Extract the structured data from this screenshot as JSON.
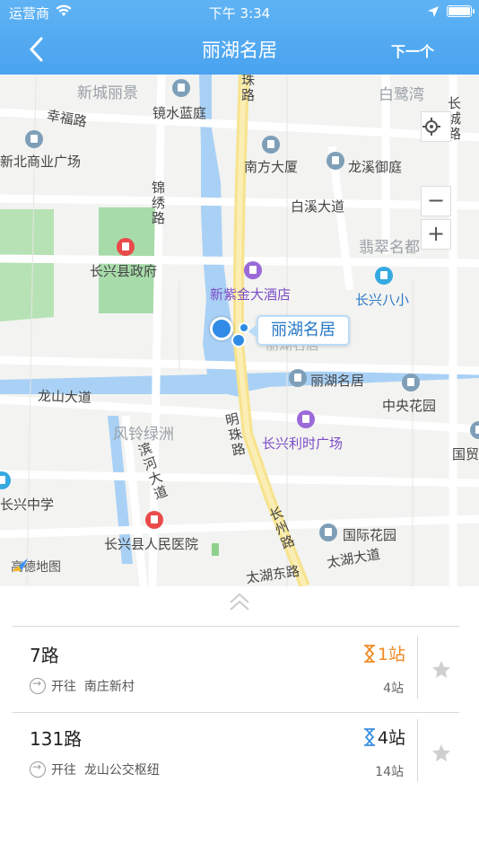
{
  "status_bar": {
    "carrier": "运营商",
    "time": "下午 3:34"
  },
  "nav": {
    "title": "丽湖名居",
    "next_label": "下一个"
  },
  "map": {
    "labels": {
      "xincheng": "新城丽景",
      "jingshui": "镜水蓝庭",
      "bailu": "白鹭湾",
      "xingfu_road": "幸福路",
      "zhu_road": "珠路",
      "changcheng_road": "长城路",
      "xinbei": "新北商业广场",
      "nanfang": "南方大厦",
      "longxi": "龙溪御庭",
      "jinxiu_road": "锦绣路",
      "baixi_road": "白溪大道",
      "feicui": "翡翠名都",
      "government": "长兴县政府",
      "xinzijin": "新紫金大酒店",
      "bazhong": "长兴八小",
      "lihu_poi": "丽湖名居",
      "zhongyang": "中央花园",
      "longshan_road": "龙山大道",
      "fengling": "风铃绿洲",
      "mingzhu_road": "明珠路",
      "lishi": "长兴利时广场",
      "guomao": "国贸",
      "binhe_road": "滨河大道",
      "changxing_zhongxue": "长兴中学",
      "hospital": "长兴县人民医院",
      "changzhou_road": "长州路",
      "guoji": "国际花园",
      "taihu_east": "太湖东路",
      "taihu_road": "太湖大道",
      "logo": "高德地图"
    },
    "callout": "丽湖名居",
    "callout_ghost": "丽湖名居",
    "zoom_in": "+",
    "zoom_out": "−"
  },
  "routes": [
    {
      "name": "7路",
      "direction_prefix": "开往",
      "destination": "南庄新村",
      "eta": "1站",
      "eta_color": "#f08a24",
      "stops": "4站"
    },
    {
      "name": "131路",
      "direction_prefix": "开往",
      "destination": "龙山公交枢纽",
      "eta": "4站",
      "eta_color": "#222222",
      "stops": "14站"
    }
  ],
  "icons": {
    "back": "chevron-left-icon",
    "star": "star-icon",
    "hourglass": "hourglass-icon",
    "locate": "locate-icon"
  },
  "colors": {
    "header": "#4aa3ef",
    "eta_near": "#f08a24",
    "star": "#cfcfcf"
  }
}
